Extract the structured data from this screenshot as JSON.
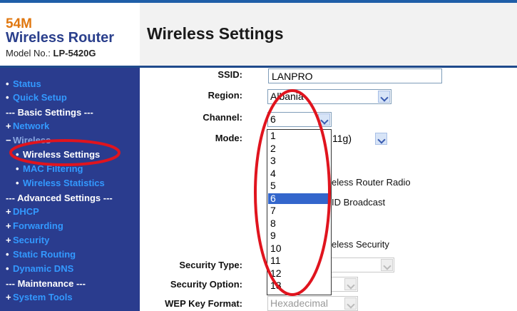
{
  "brand": {
    "line1": "54M",
    "line2": "Wireless Router",
    "model_label": "Model No.:",
    "model_value": "LP-5420G"
  },
  "page_title": "Wireless Settings",
  "sidebar": {
    "status": "Status",
    "quick_setup": "Quick Setup",
    "basic_section": "--- Basic Settings ---",
    "network": "Network",
    "wireless": "Wireless",
    "wireless_settings": "Wireless Settings",
    "mac_filtering": "MAC Filtering",
    "wireless_statistics": "Wireless Statistics",
    "advanced_section": "--- Advanced Settings ---",
    "dhcp": "DHCP",
    "forwarding": "Forwarding",
    "security": "Security",
    "static_routing": "Static Routing",
    "dynamic_dns": "Dynamic DNS",
    "maintenance_section": "--- Maintenance ---",
    "system_tools": "System Tools"
  },
  "form": {
    "ssid_label": "SSID:",
    "ssid_value": "LANPRO",
    "region_label": "Region:",
    "region_value": "Albania",
    "channel_label": "Channel:",
    "channel_value": "6",
    "mode_label": "Mode:",
    "mode_value_visible": "11g)",
    "radio_text": "eless Router Radio",
    "broadcast_text": "ID Broadcast",
    "security_text": "eless Security",
    "security_type_label": "Security Type:",
    "security_option_label": "Security Option:",
    "wep_key_format_label": "WEP Key Format:",
    "wep_key_format_value": "Hexadecimal"
  },
  "channel_options": [
    "1",
    "2",
    "3",
    "4",
    "5",
    "6",
    "7",
    "8",
    "9",
    "10",
    "11",
    "12",
    "13"
  ],
  "channel_selected": "6",
  "colors": {
    "sidebar_bg": "#2a3c8e",
    "nav_link": "#3399ff",
    "brand_orange": "#e0770f",
    "highlight_ring": "#e0141e",
    "selected_option": "#3366cc"
  }
}
